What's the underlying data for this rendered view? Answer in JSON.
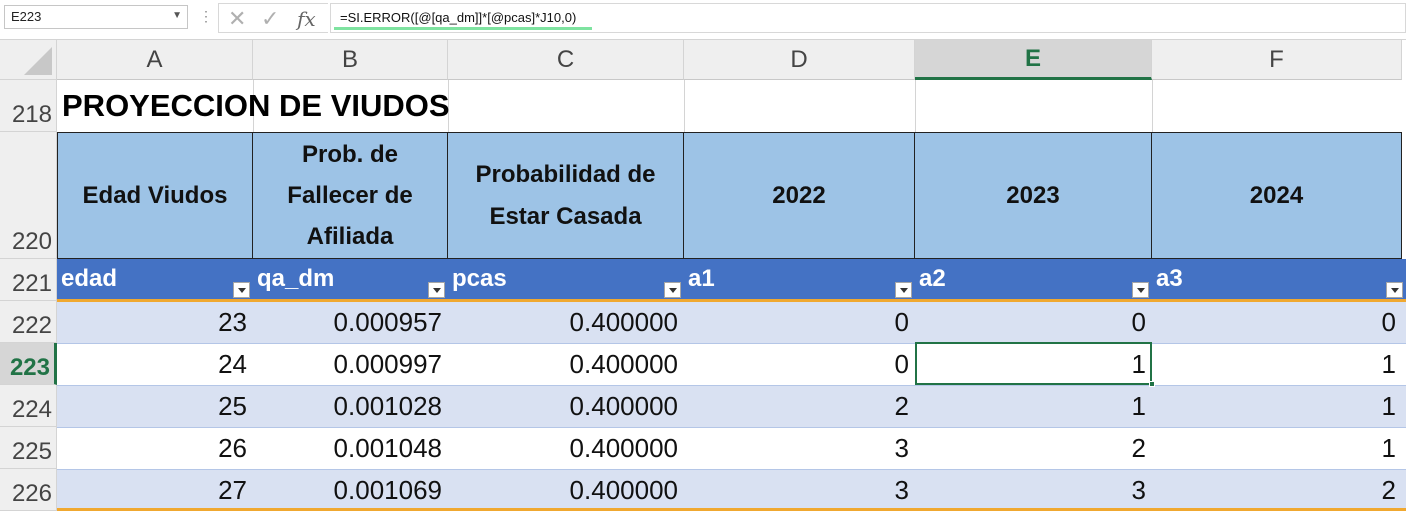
{
  "formula_bar": {
    "name_box": "E223",
    "formula": "=SI.ERROR([@[qa_dm]]*[@pcas]*J10,0)",
    "icons": [
      "cancel-icon",
      "enter-icon",
      "fx-icon"
    ]
  },
  "columns": [
    "A",
    "B",
    "C",
    "D",
    "E",
    "F"
  ],
  "selected_column": "E",
  "row_numbers": {
    "r218": "218",
    "r220": "220",
    "r221": "221",
    "r222": "222",
    "r223": "223",
    "r224": "224",
    "r225": "225",
    "r226": "226"
  },
  "selected_row": "223",
  "title": "PROYECCION DE VIUDOS",
  "headers": {
    "edad": "Edad Viudos",
    "prob_line1": "Prob. de",
    "prob_line2": "Fallecer de",
    "prob_line3": "Afiliada",
    "pcas_line1": "Probabilidad de",
    "pcas_line2": "Estar Casada",
    "y2022": "2022",
    "y2023": "2023",
    "y2024": "2024"
  },
  "table_columns": [
    "edad",
    "qa_dm",
    "pcas",
    "a1",
    "a2",
    "a3"
  ],
  "rows": [
    [
      "23",
      "0.000957",
      "0.400000",
      "0",
      "0",
      "0"
    ],
    [
      "24",
      "0.000997",
      "0.400000",
      "0",
      "1",
      "1"
    ],
    [
      "25",
      "0.001028",
      "0.400000",
      "2",
      "1",
      "1"
    ],
    [
      "26",
      "0.001048",
      "0.400000",
      "3",
      "2",
      "1"
    ],
    [
      "27",
      "0.001069",
      "0.400000",
      "3",
      "3",
      "2"
    ]
  ],
  "colors": {
    "header_fill": "#9dc3e6",
    "table_header_fill": "#4472c4",
    "band_fill": "#d9e1f2",
    "accent_green": "#217346",
    "total_line": "#f0a830"
  }
}
